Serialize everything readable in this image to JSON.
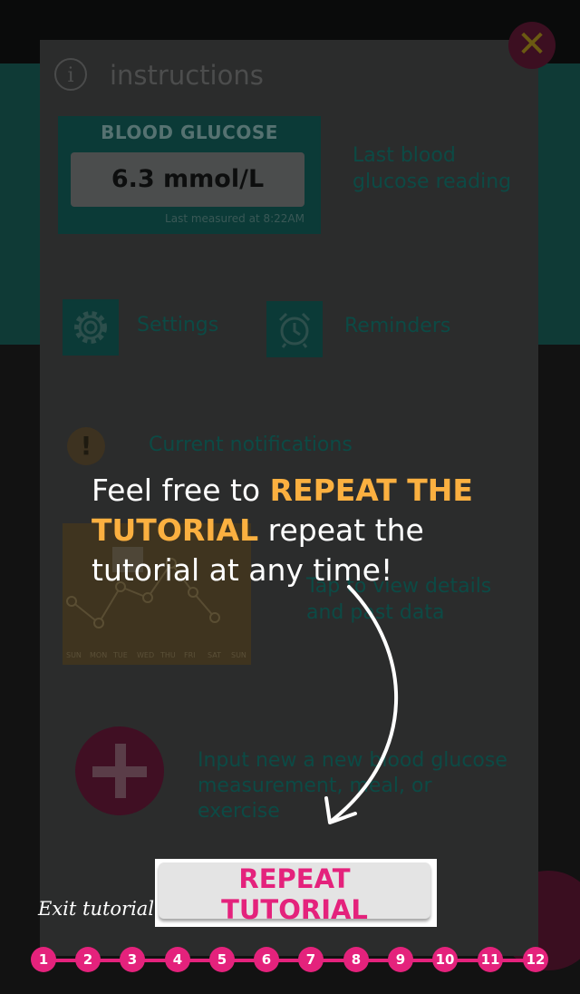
{
  "instructions": {
    "title": "instructions",
    "info_icon": "info-icon",
    "blood_glucose_card": {
      "title": "BLOOD GLUCOSE",
      "value": "6.3 mmol/L",
      "last_measured": "Last measured at 8:22AM"
    },
    "glucose_desc": "Last blood glucose reading",
    "settings_label": "Settings",
    "settings_icon": "gear-icon",
    "reminders_label": "Reminders",
    "reminders_icon": "alarm-clock-icon",
    "notifications_label": "Current notifications",
    "notifications_icon": "exclamation-icon",
    "chart_desc": "Tap to view details and past data",
    "chart_days": [
      "SUN",
      "MON",
      "TUE",
      "WED",
      "THU",
      "FRI",
      "SAT",
      "SUN"
    ],
    "input_desc": "Input new a new blood glucose measurement, meal, or exercise",
    "add_icon": "plus-icon"
  },
  "close_icon": "close-icon",
  "tutorial": {
    "message_prefix": "Feel free to",
    "message_highlight": "REPEAT THE TUTORIAL",
    "message_suffix": "repeat the tutorial at any time!",
    "repeat_button": "REPEAT TUTORIAL",
    "exit_link": "Exit tutorial",
    "steps": [
      "1",
      "2",
      "3",
      "4",
      "5",
      "6",
      "7",
      "8",
      "9",
      "10",
      "11",
      "12"
    ]
  },
  "colors": {
    "accent_pink": "#e4227c",
    "highlight_orange": "#fbb040",
    "teal": "#0b3a37"
  }
}
